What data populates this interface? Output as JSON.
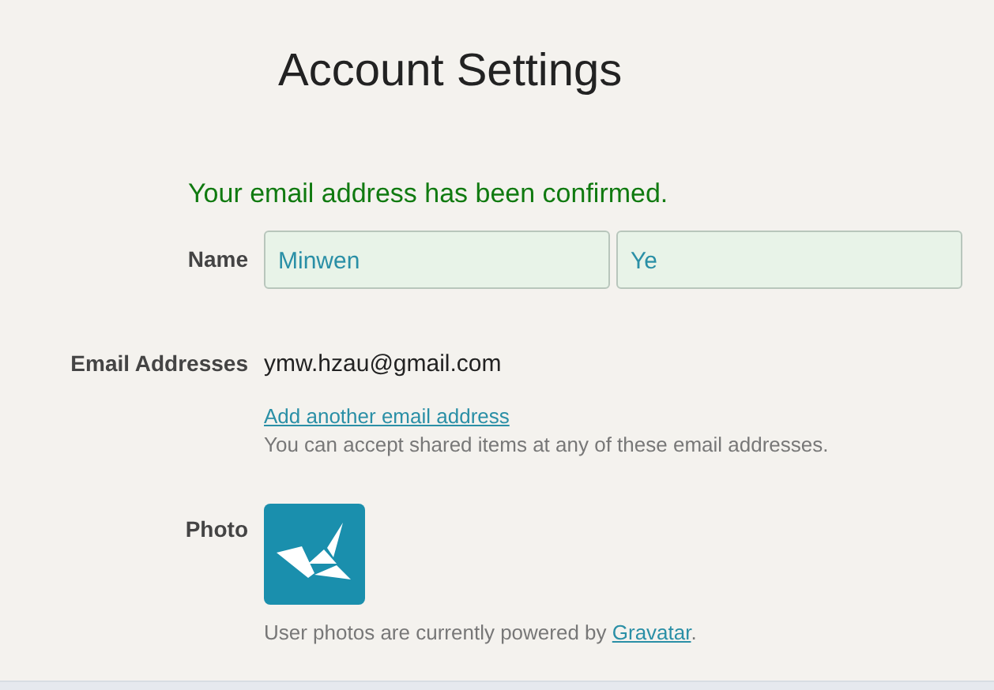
{
  "title": "Account Settings",
  "confirmation": "Your email address has been confirmed.",
  "name": {
    "label": "Name",
    "first": "Minwen",
    "last": "Ye"
  },
  "email": {
    "label": "Email Addresses",
    "address": "ymw.hzau@gmail.com",
    "add_link": "Add another email address",
    "note": "You can accept shared items at any of these email addresses."
  },
  "photo": {
    "label": "Photo",
    "note_before": "User photos are currently powered by ",
    "link": "Gravatar",
    "note_after": "."
  }
}
